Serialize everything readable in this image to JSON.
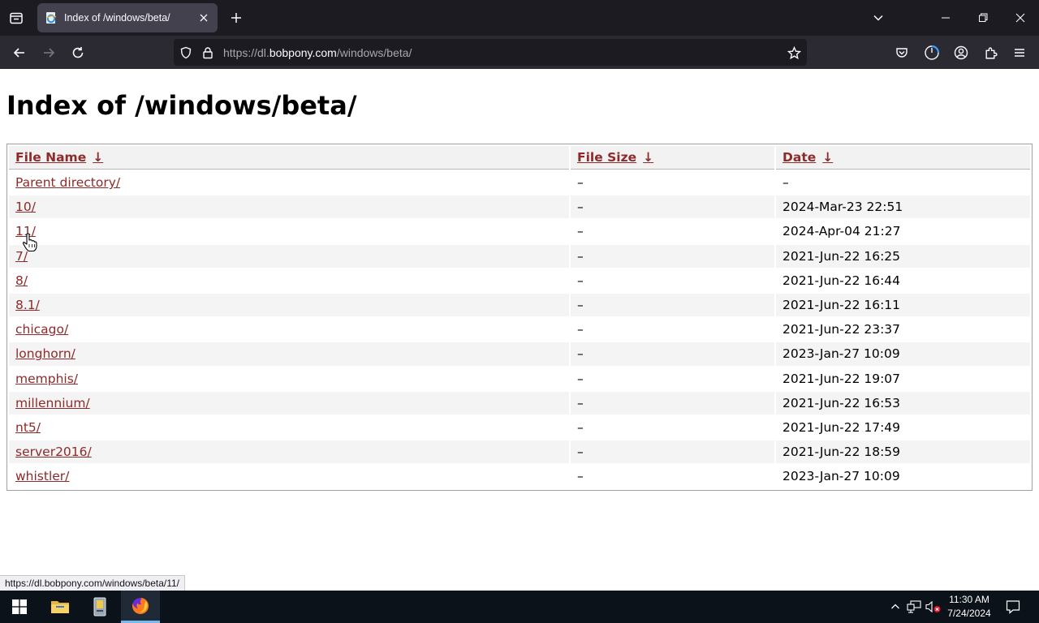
{
  "browser": {
    "tab": {
      "title": "Index of /windows/beta/",
      "favicon": "ie-page-icon"
    },
    "url": {
      "scheme": "https://dl.",
      "host": "bobpony.com",
      "path": "/windows/beta/"
    }
  },
  "page": {
    "title": "Index of /windows/beta/",
    "columns": {
      "name": "File Name",
      "size": "File Size",
      "date": "Date",
      "sort_arrow": "↓"
    },
    "rows": [
      {
        "name": "Parent directory/",
        "size": "–",
        "date": "–"
      },
      {
        "name": "10/",
        "size": "–",
        "date": "2024-Mar-23 22:51"
      },
      {
        "name": "11/",
        "size": "–",
        "date": "2024-Apr-04 21:27"
      },
      {
        "name": "7/",
        "size": "–",
        "date": "2021-Jun-22 16:25"
      },
      {
        "name": "8/",
        "size": "–",
        "date": "2021-Jun-22 16:44"
      },
      {
        "name": "8.1/",
        "size": "–",
        "date": "2021-Jun-22 16:11"
      },
      {
        "name": "chicago/",
        "size": "–",
        "date": "2021-Jun-22 23:37"
      },
      {
        "name": "longhorn/",
        "size": "–",
        "date": "2023-Jan-27 10:09"
      },
      {
        "name": "memphis/",
        "size": "–",
        "date": "2021-Jun-22 19:07"
      },
      {
        "name": "millennium/",
        "size": "–",
        "date": "2021-Jun-22 16:53"
      },
      {
        "name": "nt5/",
        "size": "–",
        "date": "2021-Jun-22 17:49"
      },
      {
        "name": "server2016/",
        "size": "–",
        "date": "2021-Jun-22 18:59"
      },
      {
        "name": "whistler/",
        "size": "–",
        "date": "2023-Jan-27 10:09"
      }
    ]
  },
  "status_bar": {
    "link_preview": "https://dl.bobpony.com/windows/beta/11/"
  },
  "taskbar": {
    "time": "11:30 AM",
    "date": "7/24/2024"
  },
  "colors": {
    "link": "#8e2a2a",
    "tabbar_bg": "#1c1b22",
    "navbar_bg": "#2b2a33",
    "taskbar_bg": "#0b1219",
    "taskbar_active_accent": "#76b9ed"
  }
}
